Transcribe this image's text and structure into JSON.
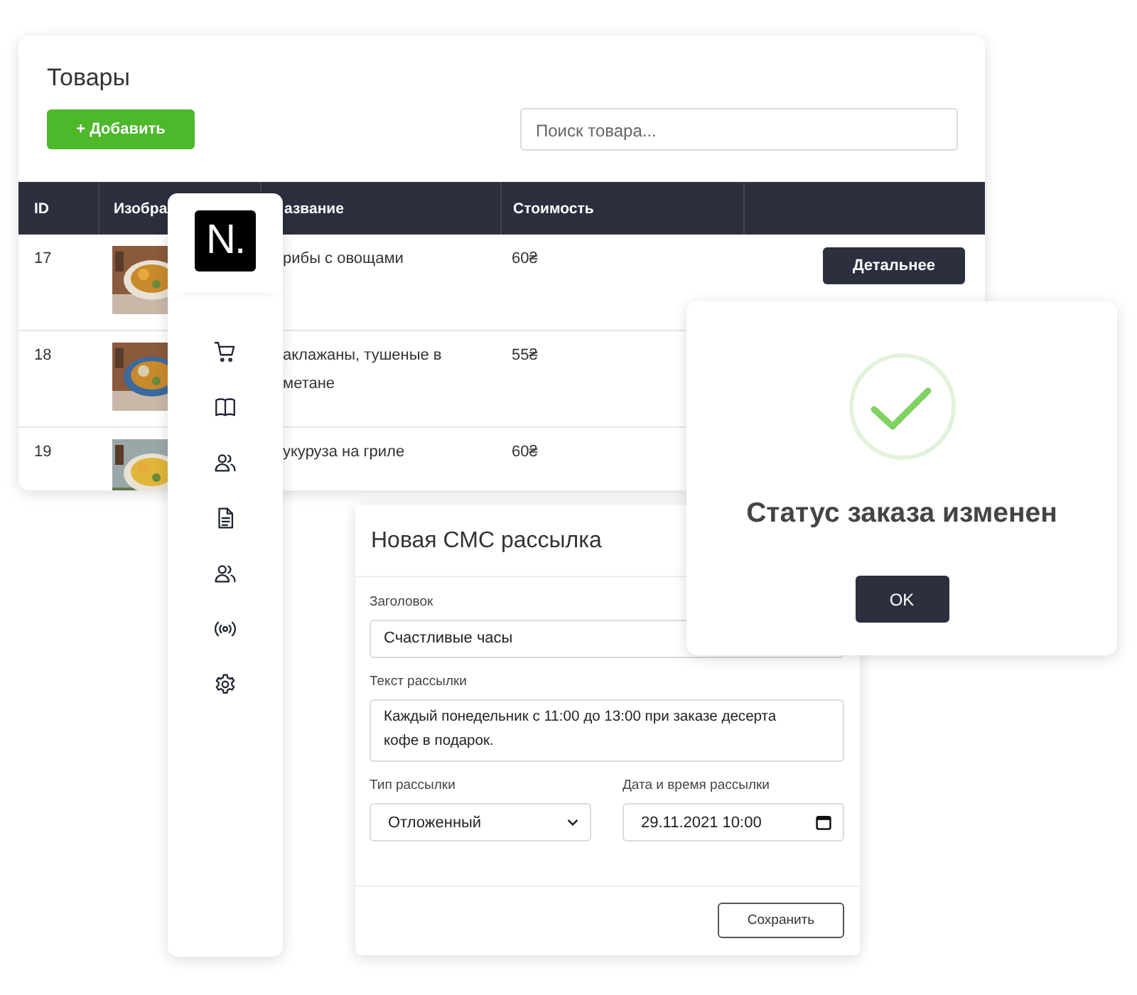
{
  "products": {
    "title": "Товары",
    "add_button": "+ Добавить",
    "search": {
      "placeholder": "Поиск товара..."
    },
    "columns": [
      "ID",
      "Изобра",
      "азвание",
      "Стоимость"
    ],
    "rows": [
      {
        "id": "17",
        "image": {
          "kind": "picture"
        },
        "name_lines": [
          "рибы с овощами"
        ],
        "price": "60₴",
        "action": "Детальнее"
      },
      {
        "id": "18",
        "image": {
          "kind": "picture"
        },
        "name_lines": [
          "аклажаны, тушеные в",
          "метане"
        ],
        "price": "55₴"
      },
      {
        "id": "19",
        "image": {
          "kind": "picture"
        },
        "name_lines": [
          "укуруза на гриле"
        ],
        "price": "60₴"
      }
    ]
  },
  "sidebar": {
    "logo": "N."
  },
  "sms_form": {
    "title": "Новая СМС рассылка",
    "fields": [
      {
        "kind": "text",
        "label": "Заголовок",
        "value": "Счастливые часы"
      },
      {
        "kind": "textarea",
        "label": "Текст рассылки",
        "value": "Каждый понедельник с 11:00 до 13:00 при заказе десерта кофе в подарок."
      },
      {
        "kind": "select",
        "label": "Тип рассылки",
        "value": "Отложенный"
      },
      {
        "kind": "datetime",
        "label": "Дата и время рассылки",
        "value": "29.11.2021 10:00"
      }
    ],
    "save_button": "Сохранить"
  },
  "dialog": {
    "message": "Статус заказа изменен",
    "ok_button": "OK"
  }
}
